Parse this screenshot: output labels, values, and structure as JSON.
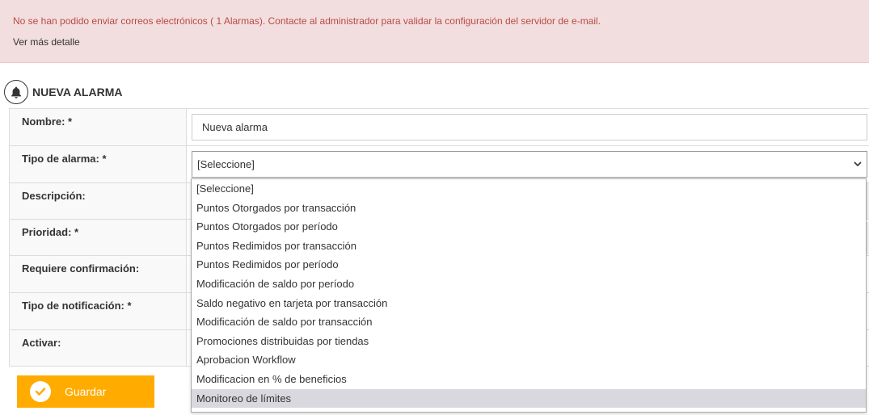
{
  "alert": {
    "message": "No se han podido enviar correos electrónicos ( 1 Alarmas). Contacte al administrador para validar la configuración del servidor de e-mail.",
    "detail_link": "Ver más detalle"
  },
  "section": {
    "title": "NUEVA ALARMA",
    "icon": "bell-icon"
  },
  "form": {
    "rows": [
      {
        "label": "Nombre: *"
      },
      {
        "label": "Tipo de alarma: *"
      },
      {
        "label": "Descripción:"
      },
      {
        "label": "Prioridad: *"
      },
      {
        "label": "Requiere confirmación:"
      },
      {
        "label": "Tipo de notificación: *"
      },
      {
        "label": "Activar:"
      }
    ],
    "nombre_value": "Nueva alarma",
    "tipo_selected": "[Seleccione]",
    "tipo_options": [
      "[Seleccione]",
      "Puntos Otorgados por transacción",
      "Puntos Otorgados por período",
      "Puntos Redimidos por transacción",
      "Puntos Redimidos por período",
      "Modificación de saldo por período",
      "Saldo negativo en tarjeta por transacción",
      "Modificación de saldo por transacción",
      "Promociones distribuidas por tiendas",
      "Aprobacion Workflow",
      "Modificacion en % de beneficios",
      "Monitoreo de límites"
    ],
    "highlighted_option": "Monitoreo de límites",
    "save_label": "Guardar"
  },
  "colors": {
    "alert_bg": "#f2dede",
    "alert_text": "#b94a48",
    "save_button": "#ffab00",
    "highlight": "#d8d8de"
  }
}
